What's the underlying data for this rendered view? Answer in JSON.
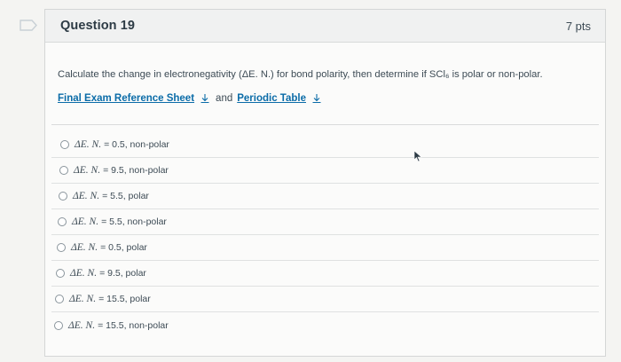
{
  "question": {
    "title": "Question 19",
    "points": "7 pts",
    "text": "Calculate the change in electronegativity (ΔE. N.) for bond polarity, then determine if SCl₆ is polar or non-polar.",
    "links": {
      "reference_sheet": "Final Exam Reference Sheet",
      "conjunction": "and",
      "periodic_table": "Periodic Table"
    }
  },
  "answers": [
    {
      "label": "ΔE. N.",
      "value": "= 0.5, non-polar"
    },
    {
      "label": "ΔE. N.",
      "value": "= 9.5, non-polar"
    },
    {
      "label": "ΔE. N.",
      "value": "= 5.5, polar"
    },
    {
      "label": "ΔE. N.",
      "value": "= 5.5, non-polar"
    },
    {
      "label": "ΔE. N.",
      "value": "= 0.5, polar"
    },
    {
      "label": "ΔE. N.",
      "value": "= 9.5, polar"
    },
    {
      "label": "ΔE. N.",
      "value": "= 15.5, polar"
    },
    {
      "label": "ΔE. N.",
      "value": "= 15.5, non-polar"
    }
  ],
  "icons": {
    "flag": "flag-outline-icon",
    "download": "download-icon",
    "cursor": "mouse-pointer-icon"
  },
  "colors": {
    "link": "#0b6ca8",
    "text": "#2d3b45",
    "header_bg": "#f0f1f1"
  }
}
